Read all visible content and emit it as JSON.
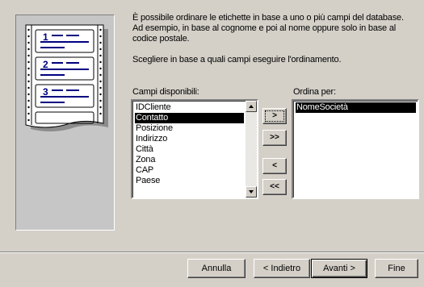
{
  "description": {
    "line1": "È possibile ordinare le etichette in base a uno o più campi del database.",
    "line2": "Ad esempio, in base al cognome e poi al nome oppure solo in base al",
    "line3": "codice postale.",
    "prompt": "Scegliere in base a quali campi eseguire l'ordinamento."
  },
  "available": {
    "label": "Campi disponibili:",
    "items": [
      "IDCliente",
      "Contatto",
      "Posizione",
      "Indirizzo",
      "Città",
      "Zona",
      "CAP",
      "Paese"
    ],
    "selected": "Contatto"
  },
  "sortby": {
    "label": "Ordina per:",
    "items": [
      "NomeSocietà"
    ],
    "selected": "NomeSocietà"
  },
  "move_buttons": {
    "add_one": ">",
    "add_all": ">>",
    "remove_one": "<",
    "remove_all": "<<"
  },
  "footer": {
    "cancel": "Annulla",
    "back": "< Indietro",
    "next": "Avanti >",
    "finish": "Fine"
  },
  "illustration": {
    "numbers": [
      "1",
      "2",
      "3"
    ]
  }
}
